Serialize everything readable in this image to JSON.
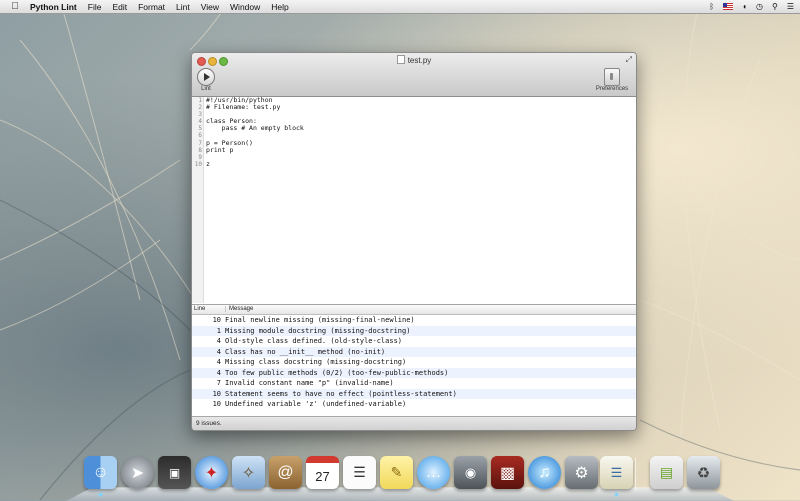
{
  "menubar": {
    "app_name": "Python Lint",
    "items": [
      "File",
      "Edit",
      "Format",
      "Lint",
      "View",
      "Window",
      "Help"
    ],
    "status_icons": [
      "bluetooth-icon",
      "flag-us-icon",
      "wifi-icon",
      "clock-icon",
      "search-icon",
      "list-icon"
    ]
  },
  "window": {
    "title": "test.py",
    "toolbar": {
      "lint_label": "Lint",
      "preferences_label": "Preferences"
    }
  },
  "editor": {
    "lines": [
      {
        "num": "1",
        "text": "#!/usr/bin/python"
      },
      {
        "num": "2",
        "text": "# Filename: test.py"
      },
      {
        "num": "3",
        "text": ""
      },
      {
        "num": "4",
        "text": "class Person:"
      },
      {
        "num": "5",
        "text": "    pass # An empty block"
      },
      {
        "num": "6",
        "text": ""
      },
      {
        "num": "7",
        "text": "p = Person()"
      },
      {
        "num": "8",
        "text": "print p"
      },
      {
        "num": "9",
        "text": ""
      },
      {
        "num": "10",
        "text": "z"
      }
    ]
  },
  "issues": {
    "columns": {
      "line": "Line",
      "message": "Message"
    },
    "rows": [
      {
        "line": "10",
        "message": "Final newline missing (missing-final-newline)"
      },
      {
        "line": "1",
        "message": "Missing module docstring (missing-docstring)"
      },
      {
        "line": "4",
        "message": "Old-style class defined. (old-style-class)"
      },
      {
        "line": "4",
        "message": "Class has no __init__ method (no-init)"
      },
      {
        "line": "4",
        "message": "Missing class docstring (missing-docstring)"
      },
      {
        "line": "4",
        "message": "Too few public methods (0/2) (too-few-public-methods)"
      },
      {
        "line": "7",
        "message": "Invalid constant name \"p\" (invalid-name)"
      },
      {
        "line": "10",
        "message": "Statement seems to have no effect (pointless-statement)"
      },
      {
        "line": "10",
        "message": "Undefined variable 'z' (undefined-variable)"
      }
    ],
    "status": "9 issues."
  },
  "dock": {
    "calendar_day": "27",
    "items": [
      "finder-icon",
      "launchpad-icon",
      "photo-booth-icon",
      "safari-icon",
      "mail-icon",
      "contacts-icon",
      "calendar-icon",
      "reminders-icon",
      "notes-icon",
      "messages-icon",
      "facetime-icon",
      "photo-viewer-icon",
      "itunes-icon",
      "system-preferences-icon",
      "python-lint-icon",
      "zip-archive-icon",
      "trash-icon"
    ]
  }
}
